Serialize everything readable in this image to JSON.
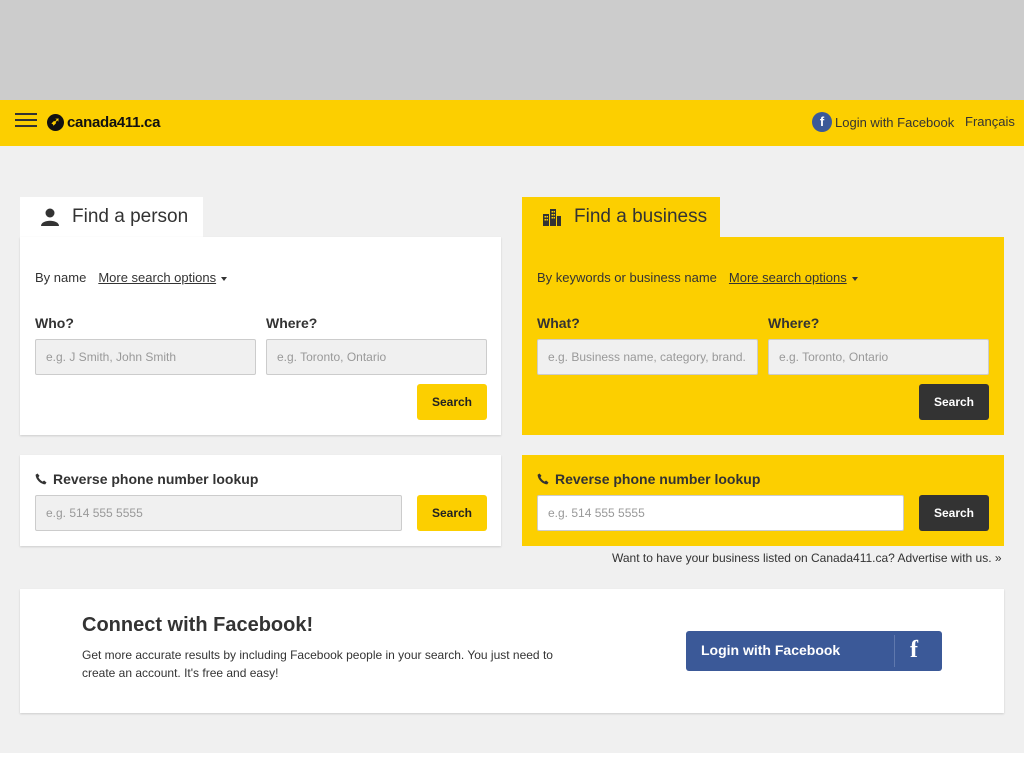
{
  "header": {
    "logo_text": "canada411.ca",
    "fb_login": "Login with Facebook",
    "fb_letter": "f",
    "language": "Français"
  },
  "person": {
    "tab_label": "Find a person",
    "filter_label": "By name",
    "more_options": "More search options",
    "who_label": "Who?",
    "who_placeholder": "e.g. J Smith, John Smith",
    "where_label": "Where?",
    "where_placeholder": "e.g. Toronto, Ontario",
    "search_label": "Search"
  },
  "person_reverse": {
    "title": "Reverse phone number lookup",
    "placeholder": "e.g. 514 555 5555",
    "search_label": "Search"
  },
  "business": {
    "tab_label": "Find a business",
    "filter_label": "By keywords or business name",
    "more_options": "More search options",
    "what_label": "What?",
    "what_placeholder": "e.g. Business name, category, brand...",
    "where_label": "Where?",
    "where_placeholder": "e.g. Toronto, Ontario",
    "search_label": "Search"
  },
  "business_reverse": {
    "title": "Reverse phone number lookup",
    "placeholder": "e.g. 514 555 5555",
    "search_label": "Search"
  },
  "advertise": "Want to have your business listed on Canada411.ca? Advertise with us. »",
  "facebook_section": {
    "title": "Connect with Facebook!",
    "description": "Get more accurate results by including Facebook people in your search. You just need to create an account. It's free and easy!",
    "button_label": "Login with Facebook",
    "button_icon": "f"
  },
  "colors": {
    "brand_yellow": "#fccf00",
    "dark_button": "#333333",
    "facebook_blue": "#3b5998"
  }
}
